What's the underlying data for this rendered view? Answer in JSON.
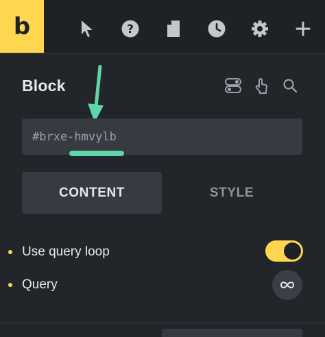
{
  "app": {
    "logo_letter": "b"
  },
  "toolbar": {
    "icons": [
      "pointer-icon",
      "help-icon",
      "page-icon",
      "history-icon",
      "settings-icon",
      "add-icon"
    ]
  },
  "panel": {
    "title": "Block",
    "title_icons": [
      "toggle-conditions-icon",
      "interactions-icon",
      "search-icon"
    ]
  },
  "css_id_field": {
    "value": "#brxe-hmvylb"
  },
  "tabs": [
    {
      "label": "CONTENT",
      "active": true
    },
    {
      "label": "STYLE",
      "active": false
    }
  ],
  "controls": [
    {
      "label": "Use query loop",
      "type": "toggle",
      "checked": true
    },
    {
      "label": "Query",
      "type": "infinity-button"
    }
  ],
  "colors": {
    "accent": "#ffd64f",
    "annotation": "#5fd6a8",
    "background": "#22262b",
    "field": "#363b41"
  }
}
